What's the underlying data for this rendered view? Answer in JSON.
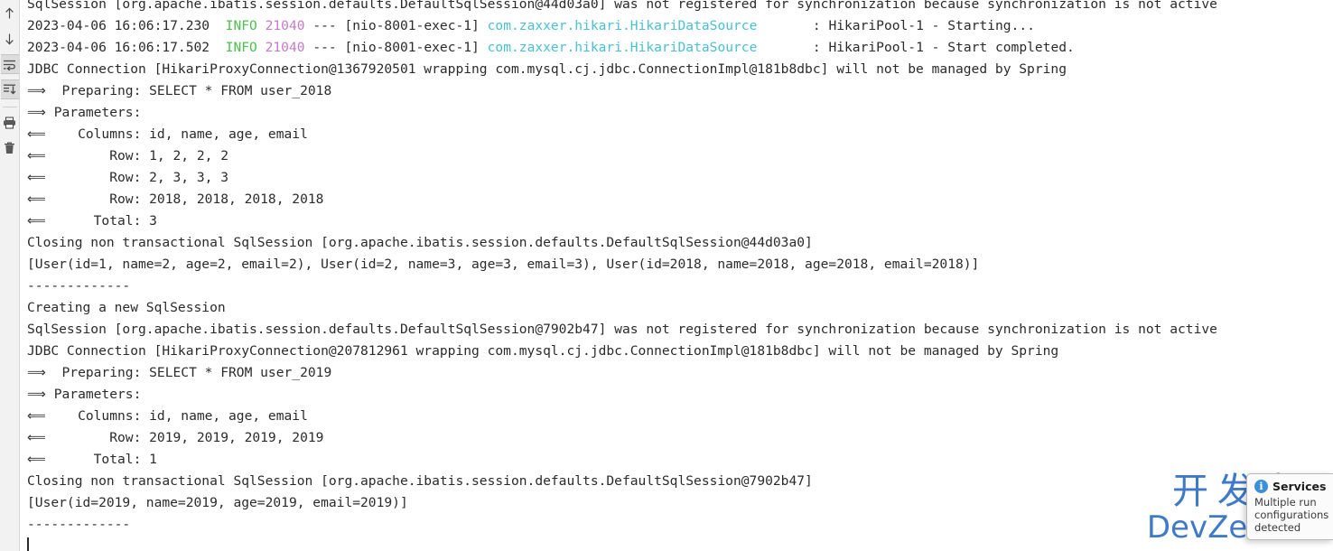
{
  "gutter": {
    "tools": [
      {
        "name": "scroll-up-icon",
        "title": "Up",
        "toggled": false
      },
      {
        "name": "scroll-down-icon",
        "title": "Down",
        "toggled": false
      },
      {
        "name": "soft-wrap-icon",
        "title": "Soft-Wrap",
        "toggled": true
      },
      {
        "name": "scroll-to-end-icon",
        "title": "Scroll to End",
        "toggled": true
      },
      {
        "name": "print-icon",
        "title": "Print",
        "toggled": false
      },
      {
        "name": "trash-icon",
        "title": "Clear All",
        "toggled": false
      }
    ]
  },
  "console": {
    "colors": {
      "background": "#ffffff",
      "text": "#2b2b2b",
      "info": "#4ec04e",
      "pid": "#c77ac7",
      "logger": "#49c0d0"
    },
    "lines": [
      {
        "type": "plain",
        "text": "SqlSession [org.apache.ibatis.session.defaults.DefaultSqlSession@44d03a0] was not registered for synchronization because synchronization is not active"
      },
      {
        "type": "log",
        "timestamp": "2023-04-06 16:06:17.230",
        "level": "INFO",
        "pid": "21040",
        "sep": "---",
        "thread": "[nio-8001-exec-1]",
        "logger": "com.zaxxer.hikari.HikariDataSource",
        "pad": "       ",
        "message": ": HikariPool-1 - Starting..."
      },
      {
        "type": "log",
        "timestamp": "2023-04-06 16:06:17.502",
        "level": "INFO",
        "pid": "21040",
        "sep": "---",
        "thread": "[nio-8001-exec-1]",
        "logger": "com.zaxxer.hikari.HikariDataSource",
        "pad": "       ",
        "message": ": HikariPool-1 - Start completed."
      },
      {
        "type": "plain",
        "text": "JDBC Connection [HikariProxyConnection@1367920501 wrapping com.mysql.cj.jdbc.ConnectionImpl@181b8dbc] will not be managed by Spring"
      },
      {
        "type": "plain",
        "text": "==>  Preparing: SELECT * FROM user_2018"
      },
      {
        "type": "plain",
        "text": "==> Parameters: "
      },
      {
        "type": "plain",
        "text": "<==    Columns: id, name, age, email"
      },
      {
        "type": "plain",
        "text": "<==        Row: 1, 2, 2, 2"
      },
      {
        "type": "plain",
        "text": "<==        Row: 2, 3, 3, 3"
      },
      {
        "type": "plain",
        "text": "<==        Row: 2018, 2018, 2018, 2018"
      },
      {
        "type": "plain",
        "text": "<==      Total: 3"
      },
      {
        "type": "plain",
        "text": "Closing non transactional SqlSession [org.apache.ibatis.session.defaults.DefaultSqlSession@44d03a0]"
      },
      {
        "type": "plain",
        "text": "[User(id=1, name=2, age=2, email=2), User(id=2, name=3, age=3, email=3), User(id=2018, name=2018, age=2018, email=2018)]"
      },
      {
        "type": "plain",
        "text": "-------------"
      },
      {
        "type": "plain",
        "text": "Creating a new SqlSession"
      },
      {
        "type": "plain",
        "text": "SqlSession [org.apache.ibatis.session.defaults.DefaultSqlSession@7902b47] was not registered for synchronization because synchronization is not active"
      },
      {
        "type": "plain",
        "text": "JDBC Connection [HikariProxyConnection@207812961 wrapping com.mysql.cj.jdbc.ConnectionImpl@181b8dbc] will not be managed by Spring"
      },
      {
        "type": "plain",
        "text": "==>  Preparing: SELECT * FROM user_2019"
      },
      {
        "type": "plain",
        "text": "==> Parameters: "
      },
      {
        "type": "plain",
        "text": "<==    Columns: id, name, age, email"
      },
      {
        "type": "plain",
        "text": "<==        Row: 2019, 2019, 2019, 2019"
      },
      {
        "type": "plain",
        "text": "<==      Total: 1"
      },
      {
        "type": "plain",
        "text": "Closing non transactional SqlSession [org.apache.ibatis.session.defaults.DefaultSqlSession@7902b47]"
      },
      {
        "type": "plain",
        "text": "[User(id=2019, name=2019, age=2019, email=2019)]"
      },
      {
        "type": "plain",
        "text": "-------------"
      },
      {
        "type": "caret",
        "text": ""
      }
    ]
  },
  "services_popup": {
    "icon": "info-icon",
    "badge_glyph": "i",
    "title": "Services",
    "body": "Multiple run configurations detected"
  },
  "watermark": {
    "line1": "开发者",
    "line2": "DevZe.CoM",
    "color": "#2f6fc4"
  }
}
